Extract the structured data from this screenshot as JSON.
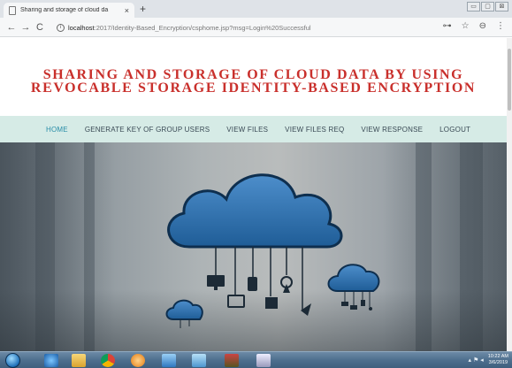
{
  "browser": {
    "tab_title": "Sharing and storage of cloud da",
    "tab_close": "×",
    "new_tab": "+",
    "back": "←",
    "forward": "→",
    "reload": "C",
    "info": "i",
    "url_host": "localhost",
    "url_path": ":2017/Identity-Based_Encryption/csphome.jsp?msg=Login%20Successful",
    "key_icon": "⊶",
    "star_icon": "☆",
    "account_icon": "⊖",
    "menu_icon": "⋮",
    "window_controls": [
      "▭",
      "▢",
      "⊠"
    ]
  },
  "page": {
    "title": "SHARING AND STORAGE OF CLOUD DATA BY USING REVOCABLE STORAGE IDENTITY-BASED ENCRYPTION",
    "nav": [
      {
        "label": "HOME",
        "active": true
      },
      {
        "label": "GENERATE KEY OF GROUP USERS",
        "active": false
      },
      {
        "label": "VIEW FILES",
        "active": false
      },
      {
        "label": "VIEW FILES REQ",
        "active": false
      },
      {
        "label": "VIEW RESPONSE",
        "active": false
      },
      {
        "label": "LOGOUT",
        "active": false
      }
    ],
    "hero_image": "cloud-network-icon"
  },
  "taskbar": {
    "apps": [
      "ie-icon",
      "explorer-icon",
      "chrome-icon",
      "media-icon",
      "app-icon",
      "app-icon-2",
      "app-icon-3",
      "app-icon-4"
    ],
    "tray": "▴ ⚑ ◂",
    "time": "10:22 AM",
    "date": "3/6/2019"
  },
  "colors": {
    "title_red": "#c9302c",
    "nav_bg": "#d6ebe6",
    "nav_active": "#2a8ea8",
    "cloud_blue": "#2d6fa8"
  }
}
